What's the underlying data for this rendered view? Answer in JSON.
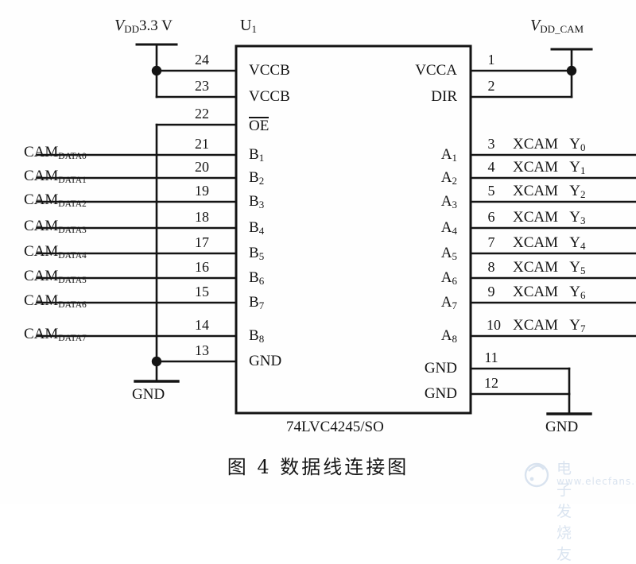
{
  "figure": {
    "caption": "图 4    数据线连接图",
    "chip_reference": "U",
    "chip_reference_sub": "1",
    "chip_part_number": "74LVC4245/SO"
  },
  "power": {
    "left_supply_prefix": "V",
    "left_supply_sub": "DD",
    "left_supply_value": "3.3 V",
    "right_supply_prefix": "V",
    "right_supply_sub": "DD_CAM",
    "ground_label_left": "GND",
    "ground_label_right": "GND"
  },
  "left_pins": [
    {
      "number": "24",
      "name": "VCCB",
      "signal": ""
    },
    {
      "number": "23",
      "name": "VCCB",
      "signal": ""
    },
    {
      "number": "22",
      "name": "OE",
      "signal": "",
      "overbar": true
    },
    {
      "number": "21",
      "name": "B",
      "name_sub": "1",
      "signal": "CAM",
      "signal_sub": "DATA0"
    },
    {
      "number": "20",
      "name": "B",
      "name_sub": "2",
      "signal": "CAM",
      "signal_sub": "DATA1"
    },
    {
      "number": "19",
      "name": "B",
      "name_sub": "3",
      "signal": "CAM",
      "signal_sub": "DATA2"
    },
    {
      "number": "18",
      "name": "B",
      "name_sub": "4",
      "signal": "CAM",
      "signal_sub": "DATA3"
    },
    {
      "number": "17",
      "name": "B",
      "name_sub": "5",
      "signal": "CAM",
      "signal_sub": "DATA4"
    },
    {
      "number": "16",
      "name": "B",
      "name_sub": "6",
      "signal": "CAM",
      "signal_sub": "DATA5"
    },
    {
      "number": "15",
      "name": "B",
      "name_sub": "7",
      "signal": "CAM",
      "signal_sub": "DATA6"
    },
    {
      "number": "14",
      "name": "B",
      "name_sub": "8",
      "signal": "CAM",
      "signal_sub": "DATA7"
    },
    {
      "number": "13",
      "name": "GND",
      "signal": ""
    }
  ],
  "right_pins": [
    {
      "number": "1",
      "name": "VCCA",
      "net": ""
    },
    {
      "number": "2",
      "name": "DIR",
      "net": ""
    },
    {
      "number": "3",
      "name": "A",
      "name_sub": "1",
      "net": "XCAM",
      "net_sub": "0",
      "net_name": "Y"
    },
    {
      "number": "4",
      "name": "A",
      "name_sub": "2",
      "net": "XCAM",
      "net_sub": "1",
      "net_name": "Y"
    },
    {
      "number": "5",
      "name": "A",
      "name_sub": "3",
      "net": "XCAM",
      "net_sub": "2",
      "net_name": "Y"
    },
    {
      "number": "6",
      "name": "A",
      "name_sub": "4",
      "net": "XCAM",
      "net_sub": "3",
      "net_name": "Y"
    },
    {
      "number": "7",
      "name": "A",
      "name_sub": "5",
      "net": "XCAM",
      "net_sub": "4",
      "net_name": "Y"
    },
    {
      "number": "8",
      "name": "A",
      "name_sub": "6",
      "net": "XCAM",
      "net_sub": "5",
      "net_name": "Y"
    },
    {
      "number": "9",
      "name": "A",
      "name_sub": "7",
      "net": "XCAM",
      "net_sub": "6",
      "net_name": "Y"
    },
    {
      "number": "10",
      "name": "A",
      "name_sub": "8",
      "net": "XCAM",
      "net_sub": "7",
      "net_name": "Y"
    },
    {
      "number": "11",
      "name": "GND",
      "net": ""
    },
    {
      "number": "12",
      "name": "GND",
      "net": ""
    }
  ],
  "watermark": {
    "line1": "电子发烧友",
    "line2": "www.elecfans.com"
  },
  "colors": {
    "line": "#141414",
    "text": "#141414",
    "background": "#ffffff",
    "watermark": "#2b62a8"
  }
}
